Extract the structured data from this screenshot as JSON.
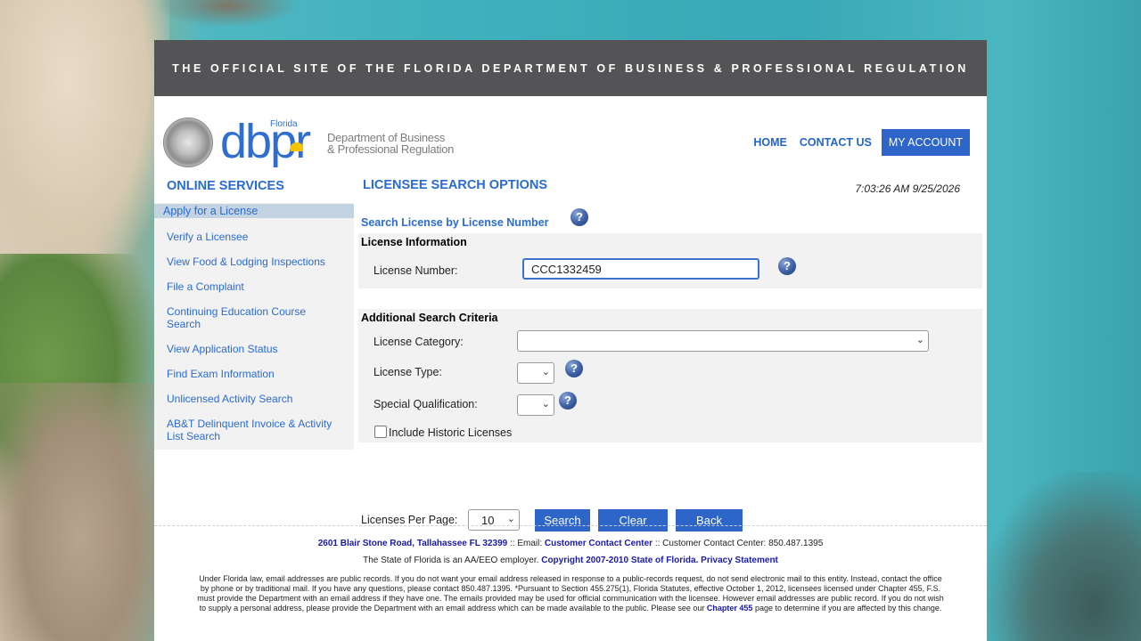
{
  "topbar": {
    "title": "THE OFFICIAL SITE OF THE FLORIDA DEPARTMENT OF BUSINESS & PROFESSIONAL REGULATION"
  },
  "logo": {
    "brand": "dbpr",
    "state": "Florida",
    "dept_line1": "Department of Business",
    "dept_line2": "& Professional Regulation"
  },
  "nav": {
    "home": "HOME",
    "contact": "CONTACT US",
    "account": "MY ACCOUNT"
  },
  "sidebar": {
    "title": "ONLINE SERVICES",
    "active": "Apply for a License",
    "items": [
      "Verify a Licensee",
      "View Food & Lodging Inspections",
      "File a Complaint",
      "Continuing Education Course Search",
      "View Application Status",
      "Find Exam Information",
      "Unlicensed Activity Search",
      "AB&T Delinquent Invoice & Activity List Search"
    ]
  },
  "main": {
    "title": "LICENSEE SEARCH OPTIONS",
    "datetime": "7:03:26 AM 9/25/2026",
    "subtitle": "Search License by License Number",
    "license_info": {
      "heading": "License Information",
      "number_label": "License Number:",
      "number_value": "CCC1332459"
    },
    "criteria": {
      "heading": "Additional Search Criteria",
      "category_label": "License Category:",
      "category_value": "",
      "type_label": "License Type:",
      "special_label": "Special Qualification:",
      "historic_label": "Include Historic Licenses",
      "historic_checked": false
    },
    "per_page_label": "Licenses Per Page:",
    "per_page_value": "10",
    "buttons": {
      "search": "Search",
      "clear": "Clear",
      "back": "Back"
    }
  },
  "icons": {
    "help": "?",
    "chevron": "⌄"
  },
  "footer": {
    "address": "2601 Blair Stone Road, Tallahassee FL 32399",
    "sep1": " :: Email: ",
    "email_link": "Customer Contact Center",
    "sep2": " :: Customer Contact Center: 850.487.1395",
    "eeo": "The State of Florida is an AA/EEO employer. ",
    "copyright": "Copyright 2007-2010 State of Florida.",
    "privacy": "Privacy Statement",
    "notice_a": "Under Florida law, email addresses are public records. If you do not want your email address released in response to a public-records request, do not send electronic mail to this entity. Instead, contact the office by phone or by traditional mail. If you have any questions, please contact 850.487.1395. *Pursuant to Section 455.275(1), Florida Statutes, effective October 1, 2012, licensees licensed under Chapter 455, F.S. must provide the Department with an email address if they have one. The emails provided may be used for official communication with the licensee. However email addresses are public record. If you do not wish to supply a personal address, please provide the Department with an email address which can be made available to the public. Please see our ",
    "chapter_link": "Chapter 455",
    "notice_b": " page to determine if you are affected by this change."
  }
}
